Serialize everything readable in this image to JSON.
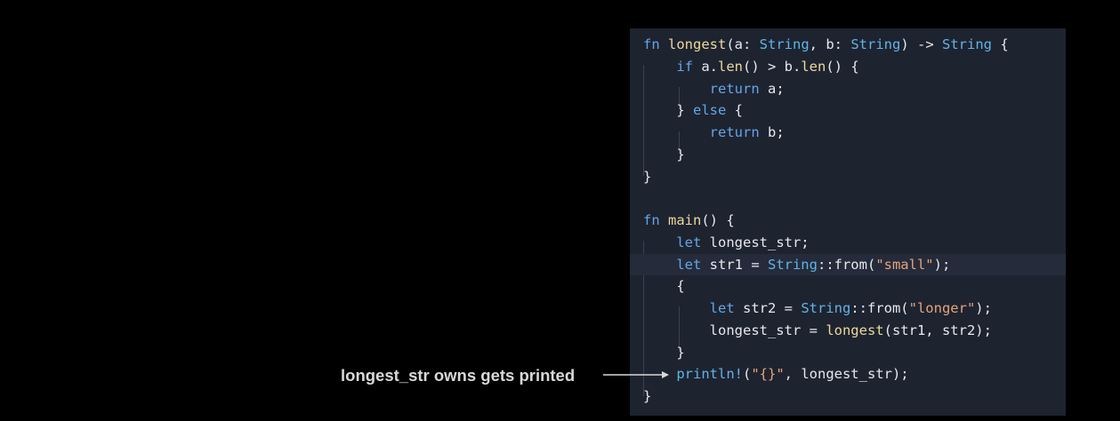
{
  "annotation": {
    "text": "longest_str owns gets printed"
  },
  "code": {
    "highlighted_line": 10,
    "colors": {
      "background": "#1e2330",
      "keyword": "#62a7e6",
      "function": "#ecd99a",
      "type": "#5fb4e6",
      "string": "#e3a57a",
      "text": "#e6e8ec"
    },
    "lines": [
      [
        {
          "t": "fn ",
          "c": "kw"
        },
        {
          "t": "longest",
          "c": "fn"
        },
        {
          "t": "(a: ",
          "c": "plain"
        },
        {
          "t": "String",
          "c": "ty"
        },
        {
          "t": ", b: ",
          "c": "plain"
        },
        {
          "t": "String",
          "c": "ty"
        },
        {
          "t": ") -> ",
          "c": "plain"
        },
        {
          "t": "String",
          "c": "ty"
        },
        {
          "t": " {",
          "c": "plain"
        }
      ],
      [
        {
          "t": "    ",
          "c": "plain"
        },
        {
          "t": "if",
          "c": "kw"
        },
        {
          "t": " a.",
          "c": "plain"
        },
        {
          "t": "len",
          "c": "fn"
        },
        {
          "t": "() > b.",
          "c": "plain"
        },
        {
          "t": "len",
          "c": "fn"
        },
        {
          "t": "() {",
          "c": "plain"
        }
      ],
      [
        {
          "t": "        ",
          "c": "plain"
        },
        {
          "t": "return",
          "c": "kw"
        },
        {
          "t": " a;",
          "c": "plain"
        }
      ],
      [
        {
          "t": "    } ",
          "c": "plain"
        },
        {
          "t": "else",
          "c": "kw"
        },
        {
          "t": " {",
          "c": "plain"
        }
      ],
      [
        {
          "t": "        ",
          "c": "plain"
        },
        {
          "t": "return",
          "c": "kw"
        },
        {
          "t": " b;",
          "c": "plain"
        }
      ],
      [
        {
          "t": "    }",
          "c": "plain"
        }
      ],
      [
        {
          "t": "}",
          "c": "plain"
        }
      ],
      [
        {
          "t": "",
          "c": "plain"
        }
      ],
      [
        {
          "t": "fn ",
          "c": "kw"
        },
        {
          "t": "main",
          "c": "fn"
        },
        {
          "t": "() {",
          "c": "plain"
        }
      ],
      [
        {
          "t": "    ",
          "c": "plain"
        },
        {
          "t": "let",
          "c": "kw"
        },
        {
          "t": " longest_str;",
          "c": "plain"
        }
      ],
      [
        {
          "t": "    ",
          "c": "plain"
        },
        {
          "t": "let",
          "c": "kw"
        },
        {
          "t": " str1 = ",
          "c": "plain"
        },
        {
          "t": "String",
          "c": "ty"
        },
        {
          "t": "::from(",
          "c": "plain"
        },
        {
          "t": "\"small\"",
          "c": "str"
        },
        {
          "t": ");",
          "c": "plain"
        }
      ],
      [
        {
          "t": "    {",
          "c": "plain"
        }
      ],
      [
        {
          "t": "        ",
          "c": "plain"
        },
        {
          "t": "let",
          "c": "kw"
        },
        {
          "t": " str2 = ",
          "c": "plain"
        },
        {
          "t": "String",
          "c": "ty"
        },
        {
          "t": "::from(",
          "c": "plain"
        },
        {
          "t": "\"longer\"",
          "c": "str"
        },
        {
          "t": ");",
          "c": "plain"
        }
      ],
      [
        {
          "t": "        longest_str = ",
          "c": "plain"
        },
        {
          "t": "longest",
          "c": "fn"
        },
        {
          "t": "(str1, str2);",
          "c": "plain"
        }
      ],
      [
        {
          "t": "    }",
          "c": "plain"
        }
      ],
      [
        {
          "t": "    ",
          "c": "plain"
        },
        {
          "t": "println!",
          "c": "ty"
        },
        {
          "t": "(",
          "c": "plain"
        },
        {
          "t": "\"{}\"",
          "c": "str"
        },
        {
          "t": ", longest_str);",
          "c": "plain"
        }
      ],
      [
        {
          "t": "}",
          "c": "plain"
        }
      ]
    ]
  }
}
